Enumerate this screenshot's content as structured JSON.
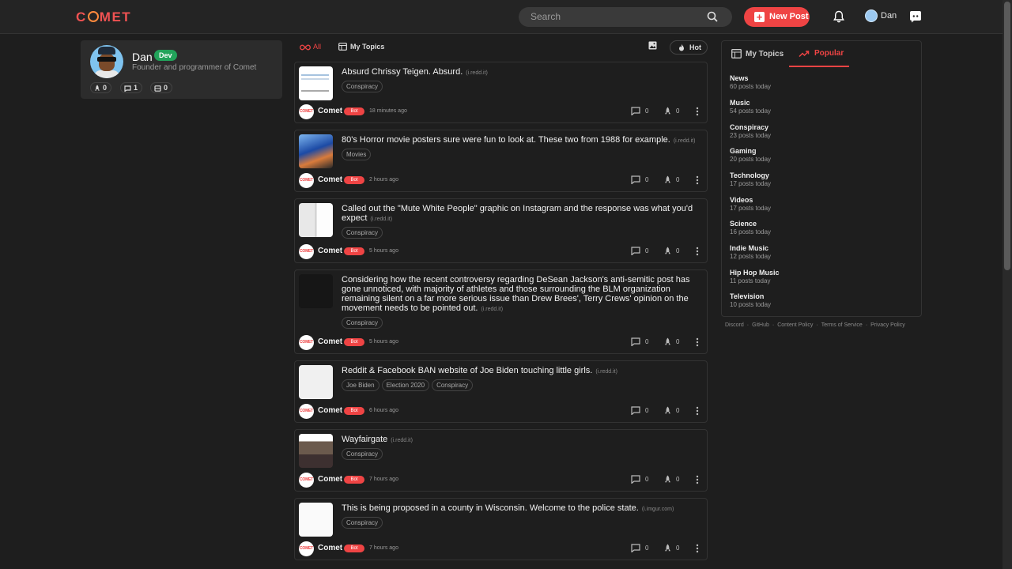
{
  "header": {
    "logo": "COMET",
    "search_placeholder": "Search",
    "new_post_label": "New Post",
    "username": "Dan"
  },
  "profile": {
    "name": "Dan",
    "badge": "Dev",
    "description": "Founder and programmer of Comet",
    "stats": {
      "rockets": "0",
      "comments": "1",
      "servers": "0"
    }
  },
  "feed": {
    "tab_all": "All",
    "tab_mytopics": "My Topics",
    "sort_label": "Hot",
    "posts": [
      {
        "title": "Absurd Chrissy Teigen. Absurd.",
        "domain": "(i.redd.it)",
        "tags": [
          "Conspiracy"
        ],
        "author": "Comet",
        "bot": "Bot",
        "time": "18 minutes ago",
        "comments": "0",
        "rockets": "0"
      },
      {
        "title": "80's Horror movie posters sure were fun to look at. These two from 1988 for example.",
        "domain": "(i.redd.it)",
        "tags": [
          "Movies"
        ],
        "author": "Comet",
        "bot": "Bot",
        "time": "2 hours ago",
        "comments": "0",
        "rockets": "0"
      },
      {
        "title": "Called out the \"Mute White People\" graphic on Instagram and the response was what you'd expect",
        "domain": "(i.redd.it)",
        "tags": [
          "Conspiracy"
        ],
        "author": "Comet",
        "bot": "Bot",
        "time": "5 hours ago",
        "comments": "0",
        "rockets": "0"
      },
      {
        "title": "Considering how the recent controversy regarding DeSean Jackson's anti-semitic post has gone unnoticed, with majority of athletes and those surrounding the BLM organization remaining silent on a far more serious issue than Drew Brees', Terry Crews' opinion on the movement needs to be pointed out.",
        "domain": "(i.redd.it)",
        "tags": [
          "Conspiracy"
        ],
        "author": "Comet",
        "bot": "Bot",
        "time": "5 hours ago",
        "comments": "0",
        "rockets": "0"
      },
      {
        "title": "Reddit & Facebook BAN website of Joe Biden touching little girls.",
        "domain": "(i.redd.it)",
        "tags": [
          "Joe Biden",
          "Election 2020",
          "Conspiracy"
        ],
        "author": "Comet",
        "bot": "Bot",
        "time": "6 hours ago",
        "comments": "0",
        "rockets": "0"
      },
      {
        "title": "Wayfairgate",
        "domain": "(i.redd.it)",
        "tags": [
          "Conspiracy"
        ],
        "author": "Comet",
        "bot": "Bot",
        "time": "7 hours ago",
        "comments": "0",
        "rockets": "0"
      },
      {
        "title": "This is being proposed in a county in Wisconsin. Welcome to the police state.",
        "domain": "(i.imgur.com)",
        "tags": [
          "Conspiracy"
        ],
        "author": "Comet",
        "bot": "Bot",
        "time": "7 hours ago",
        "comments": "0",
        "rockets": "0"
      }
    ]
  },
  "sidebar": {
    "tab_mytopics": "My Topics",
    "tab_popular": "Popular",
    "popular": [
      {
        "name": "News",
        "count": "60 posts today"
      },
      {
        "name": "Music",
        "count": "54 posts today"
      },
      {
        "name": "Conspiracy",
        "count": "23 posts today"
      },
      {
        "name": "Gaming",
        "count": "20 posts today"
      },
      {
        "name": "Technology",
        "count": "17 posts today"
      },
      {
        "name": "Videos",
        "count": "17 posts today"
      },
      {
        "name": "Science",
        "count": "16 posts today"
      },
      {
        "name": "Indie Music",
        "count": "12 posts today"
      },
      {
        "name": "Hip Hop Music",
        "count": "11 posts today"
      },
      {
        "name": "Television",
        "count": "10 posts today"
      }
    ],
    "footer": [
      "Discord",
      "GitHub",
      "Content Policy",
      "Terms of Service",
      "Privacy Policy"
    ]
  },
  "colors": {
    "accent": "#ef4444",
    "background": "#1e1e1e",
    "dev_badge": "#22a35a"
  }
}
